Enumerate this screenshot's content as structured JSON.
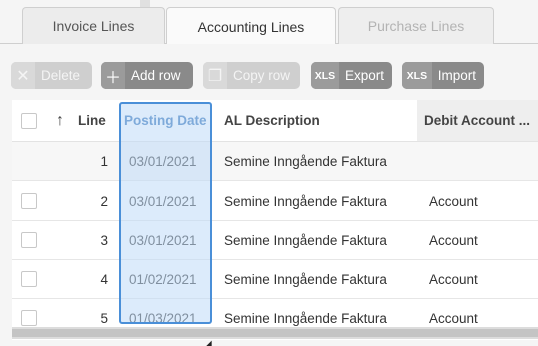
{
  "tabs": [
    {
      "label": "Invoice Lines"
    },
    {
      "label": "Accounting Lines"
    },
    {
      "label": "Purchase Lines"
    }
  ],
  "toolbar": {
    "delete_label": "Delete",
    "add_label": "Add row",
    "copy_label": "Copy row",
    "export_label": "Export",
    "import_label": "Import",
    "xls": "XLS"
  },
  "grid": {
    "headers": {
      "sort_arrow": "↑",
      "line": "Line",
      "posting_date": "Posting Date",
      "description": "AL Description",
      "debit_account": "Debit Account ..."
    },
    "rows": [
      {
        "line": "1",
        "date": "03/01/2021",
        "desc": "Semine Inngående Faktura",
        "debit": ""
      },
      {
        "line": "2",
        "date": "03/01/2021",
        "desc": "Semine Inngående Faktura",
        "debit": "Account"
      },
      {
        "line": "3",
        "date": "03/01/2021",
        "desc": "Semine Inngående Faktura",
        "debit": "Account"
      },
      {
        "line": "4",
        "date": "01/02/2021",
        "desc": "Semine Inngående Faktura",
        "debit": "Account"
      },
      {
        "line": "5",
        "date": "01/03/2021",
        "desc": "Semine Inngående Faktura",
        "debit": "Account"
      }
    ]
  }
}
